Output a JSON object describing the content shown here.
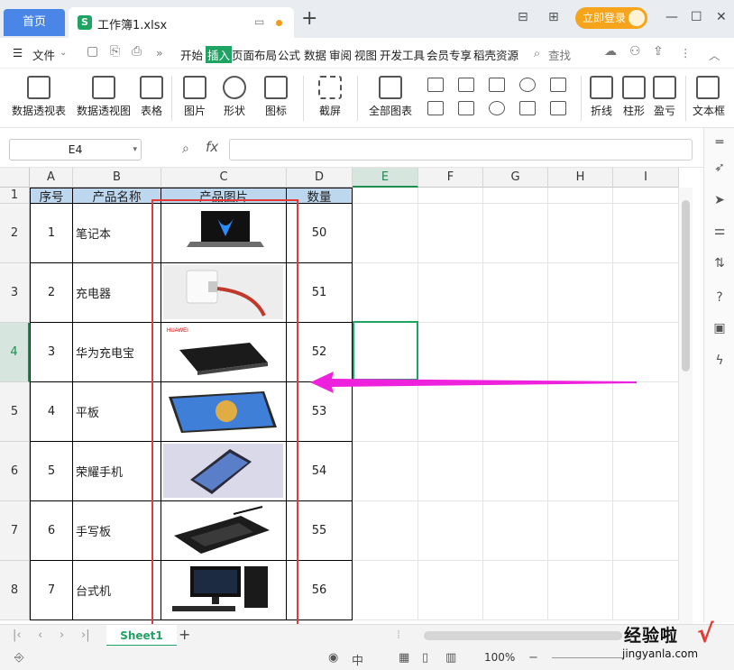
{
  "titlebar": {
    "home_tab": "首页",
    "file_tab": "工作簿1.xlsx",
    "file_icon_letter": "S",
    "login_button": "立即登录"
  },
  "menubar": {
    "file_menu": "文件",
    "items": [
      "开始",
      "插入",
      "页面布局",
      "公式",
      "数据",
      "审阅",
      "视图",
      "开发工具",
      "会员专享",
      "稻壳资源"
    ],
    "active_item": "插入",
    "search": "查找"
  },
  "ribbon": {
    "pivot_table": "数据透视表",
    "pivot_chart": "数据透视图",
    "table": "表格",
    "picture": "图片",
    "shape": "形状",
    "icon": "图标",
    "screenshot": "截屏",
    "all_charts": "全部图表",
    "line": "折线",
    "column": "柱形",
    "win_loss": "盈亏",
    "textbox": "文本框"
  },
  "formula_bar": {
    "name_box": "E4",
    "fx_label": "fx",
    "formula": ""
  },
  "sheet": {
    "columns": [
      "A",
      "B",
      "C",
      "D",
      "E",
      "F",
      "G",
      "H",
      "I"
    ],
    "selected_column": "E",
    "rows": [
      "1",
      "2",
      "3",
      "4",
      "5",
      "6",
      "7",
      "8"
    ],
    "selected_row": "4",
    "headers": [
      "序号",
      "产品名称",
      "产品图片",
      "数量"
    ],
    "data": [
      {
        "no": "1",
        "name": "笔记本",
        "qty": "50",
        "img": "laptop"
      },
      {
        "no": "2",
        "name": "充电器",
        "qty": "51",
        "img": "charger"
      },
      {
        "no": "3",
        "name": "华为充电宝",
        "qty": "52",
        "img": "powerbank"
      },
      {
        "no": "4",
        "name": "平板",
        "qty": "53",
        "img": "tablet"
      },
      {
        "no": "5",
        "name": "荣耀手机",
        "qty": "54",
        "img": "phone"
      },
      {
        "no": "6",
        "name": "手写板",
        "qty": "55",
        "img": "drawing-pad"
      },
      {
        "no": "7",
        "name": "台式机",
        "qty": "56",
        "img": "desktop-pc"
      }
    ],
    "powerbank_logo": "HUAWEI"
  },
  "sheet_tabs": {
    "active": "Sheet1"
  },
  "status": {
    "zoom": "100%"
  },
  "watermark": {
    "title": "经验啦",
    "url": "jingyanla.com",
    "check": "√"
  },
  "colors": {
    "accent_green": "#1ea362",
    "header_blue": "#bdd7ee",
    "annotation_red": "#e53935",
    "arrow_magenta": "#ee22dd"
  }
}
